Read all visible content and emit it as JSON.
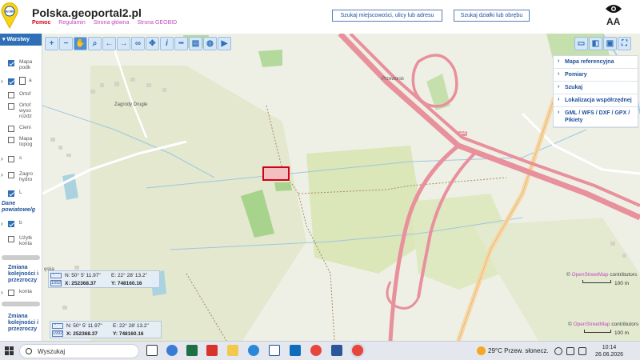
{
  "header": {
    "title": "Polska.geoportal2.pl",
    "nav": {
      "pomoc": "Pomoc",
      "regulamin": "Regulamin",
      "strona_glowna": "Strona główna",
      "strona_geobid": "Strona GEOBID"
    },
    "search_address_button": "Szukaj miejscowości, ulicy lub adresu",
    "search_parcel_button": "Szukaj działki lub obrębu",
    "font_size_label": "AA",
    "logo_text": "GEOBID"
  },
  "layers": {
    "title": "Warstwy",
    "items": [
      {
        "label": "Mapa podk",
        "checked": true
      },
      {
        "label": "a",
        "checked": true
      },
      {
        "label": "Ortof",
        "checked": false
      },
      {
        "label": "Ortof wyso rozdz",
        "checked": false
      },
      {
        "label": "Cieni",
        "checked": false
      },
      {
        "label": "Mapa topog",
        "checked": false
      },
      {
        "label": "s",
        "checked": false
      },
      {
        "label": "Zagro hydro",
        "checked": false
      },
      {
        "label": "L",
        "checked": true
      },
      {
        "label": "b",
        "checked": true
      },
      {
        "label": "Użytk konta",
        "checked": false
      }
    ],
    "section_label": "Dane powiatowe/g",
    "order_link": "Zmiana kolejności i przezroczy",
    "order_link_2": "Zmiana kolejności i przezroczy",
    "extra_item": "konta"
  },
  "right_menu": {
    "items": [
      "Mapa referencyjna",
      "Pomiary",
      "Szukaj",
      "Lokalizacja współrzędnej",
      "GML / WFS / DXF / GPX / Pikiety"
    ]
  },
  "coords": {
    "n": "N: 50° 5' 11.97\"",
    "e": "E: 22° 28' 13.2\"",
    "x": "X: 252368.37",
    "y": "Y: 748160.16",
    "crs_code": "1992",
    "crs_short": "° ' \""
  },
  "attribution": {
    "prefix": "©",
    "link": "OpenStreetMap",
    "suffix": "contributors"
  },
  "scale": "100 m",
  "map_labels": {
    "place1": "Zagrody Drugie",
    "road": "A4",
    "place2": "Przeworsk",
    "place3": "ęska"
  },
  "taskbar": {
    "search_placeholder": "Wyszukaj",
    "weather": "29°C  Przew. słonecz.",
    "time": "10:14",
    "date": "26.06.2026"
  },
  "colors": {
    "accent": "#2f6fb8",
    "highway": "#e8909c",
    "selection": "#d0021b",
    "meadow": "#dde8c0",
    "forest": "#a8d38c"
  }
}
